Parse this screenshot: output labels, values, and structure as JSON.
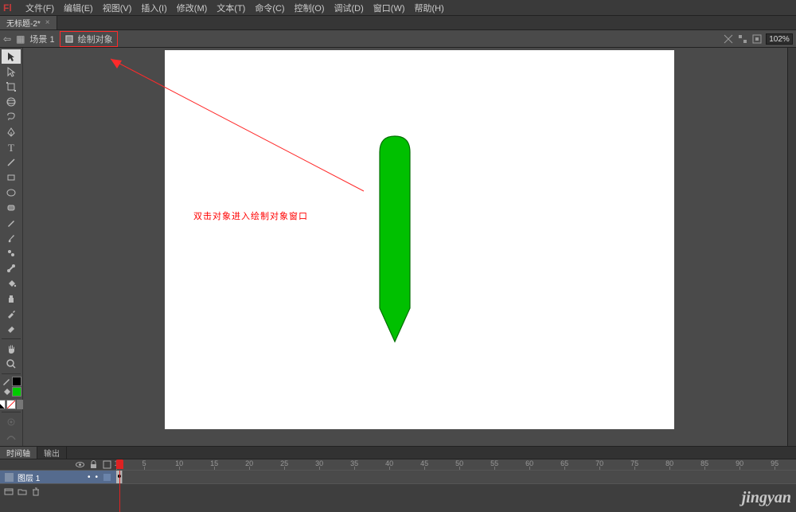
{
  "app": {
    "logo_text": "Fl"
  },
  "menu": {
    "items": [
      "文件(F)",
      "编辑(E)",
      "视图(V)",
      "插入(I)",
      "修改(M)",
      "文本(T)",
      "命令(C)",
      "控制(O)",
      "调试(D)",
      "窗口(W)",
      "帮助(H)"
    ]
  },
  "document_tab": {
    "title": "无标题-2*",
    "close_glyph": "×"
  },
  "editbar": {
    "back_glyph": "⇦",
    "scene_icon_glyph": "▦",
    "scene_label": "场景 1",
    "drawing_object_label": "绘制对象",
    "zoom_value": "102%"
  },
  "stage": {
    "callout_text": "双击对象进入绘制对象窗口",
    "shape_fill": "#00c000",
    "shape_stroke": "#007000"
  },
  "timeline": {
    "tabs": [
      "时间轴",
      "输出"
    ],
    "layer_name": "图层 1",
    "ticks": [
      1,
      5,
      10,
      15,
      20,
      25,
      30,
      35,
      40,
      45,
      50,
      55,
      60,
      65,
      70,
      75,
      80,
      85,
      90,
      95
    ],
    "tick_spacing_px": 8.8,
    "playhead_frame": 1
  },
  "watermark": "jingyan"
}
